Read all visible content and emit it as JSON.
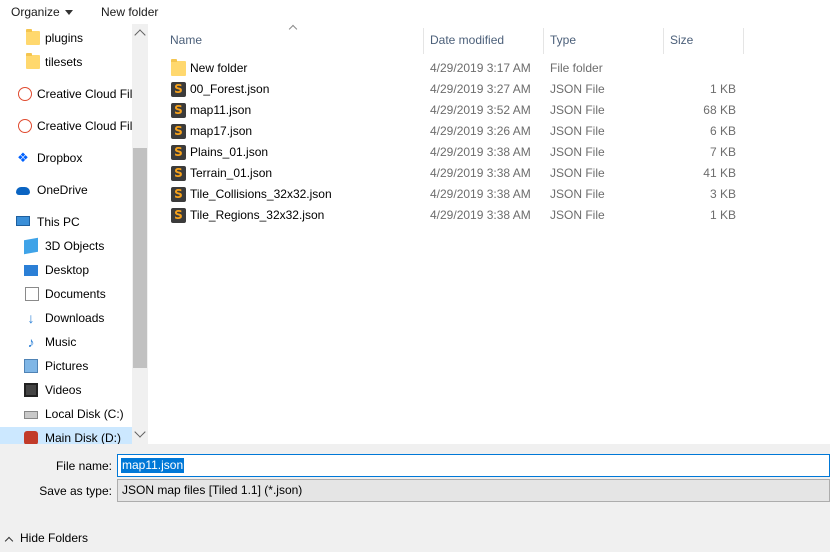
{
  "toolbar": {
    "organize_label": "Organize",
    "new_folder_label": "New folder"
  },
  "nav": {
    "items": [
      {
        "label": "plugins",
        "icon": "folder-icon"
      },
      {
        "label": "tilesets",
        "icon": "folder-icon"
      },
      {
        "label": "Creative Cloud Fil",
        "icon": "creative-cloud-icon"
      },
      {
        "label": "Creative Cloud Fil",
        "icon": "creative-cloud-icon"
      },
      {
        "label": "Dropbox",
        "icon": "dropbox-icon"
      },
      {
        "label": "OneDrive",
        "icon": "onedrive-icon"
      },
      {
        "label": "This PC",
        "icon": "computer-icon"
      },
      {
        "label": "3D Objects",
        "icon": "3d-objects-icon"
      },
      {
        "label": "Desktop",
        "icon": "desktop-icon"
      },
      {
        "label": "Documents",
        "icon": "documents-icon"
      },
      {
        "label": "Downloads",
        "icon": "downloads-icon"
      },
      {
        "label": "Music",
        "icon": "music-icon"
      },
      {
        "label": "Pictures",
        "icon": "pictures-icon"
      },
      {
        "label": "Videos",
        "icon": "videos-icon"
      },
      {
        "label": "Local Disk (C:)",
        "icon": "disk-icon"
      },
      {
        "label": "Main Disk (D:)",
        "icon": "main-disk-icon"
      }
    ]
  },
  "columns": {
    "name": "Name",
    "date": "Date modified",
    "type": "Type",
    "size": "Size"
  },
  "files": [
    {
      "name": "New folder",
      "date": "4/29/2019 3:17 AM",
      "type": "File folder",
      "size": "",
      "icon": "folder-icon"
    },
    {
      "name": "00_Forest.json",
      "date": "4/29/2019 3:27 AM",
      "type": "JSON File",
      "size": "1 KB",
      "icon": "json-file-icon"
    },
    {
      "name": "map11.json",
      "date": "4/29/2019 3:52 AM",
      "type": "JSON File",
      "size": "68 KB",
      "icon": "json-file-icon"
    },
    {
      "name": "map17.json",
      "date": "4/29/2019 3:26 AM",
      "type": "JSON File",
      "size": "6 KB",
      "icon": "json-file-icon"
    },
    {
      "name": "Plains_01.json",
      "date": "4/29/2019 3:38 AM",
      "type": "JSON File",
      "size": "7 KB",
      "icon": "json-file-icon"
    },
    {
      "name": "Terrain_01.json",
      "date": "4/29/2019 3:38 AM",
      "type": "JSON File",
      "size": "41 KB",
      "icon": "json-file-icon"
    },
    {
      "name": "Tile_Collisions_32x32.json",
      "date": "4/29/2019 3:38 AM",
      "type": "JSON File",
      "size": "3 KB",
      "icon": "json-file-icon"
    },
    {
      "name": "Tile_Regions_32x32.json",
      "date": "4/29/2019 3:38 AM",
      "type": "JSON File",
      "size": "1 KB",
      "icon": "json-file-icon"
    }
  ],
  "save": {
    "file_name_label": "File name:",
    "file_name_value": "map11.json",
    "save_as_type_label": "Save as type:",
    "save_as_type_value": "JSON map files [Tiled 1.1] (*.json)"
  },
  "footer": {
    "hide_folders_label": "Hide Folders"
  },
  "colors": {
    "selection": "#0078d7",
    "nav_selected": "#cce8ff",
    "json_icon_accent": "#f7a21b"
  }
}
